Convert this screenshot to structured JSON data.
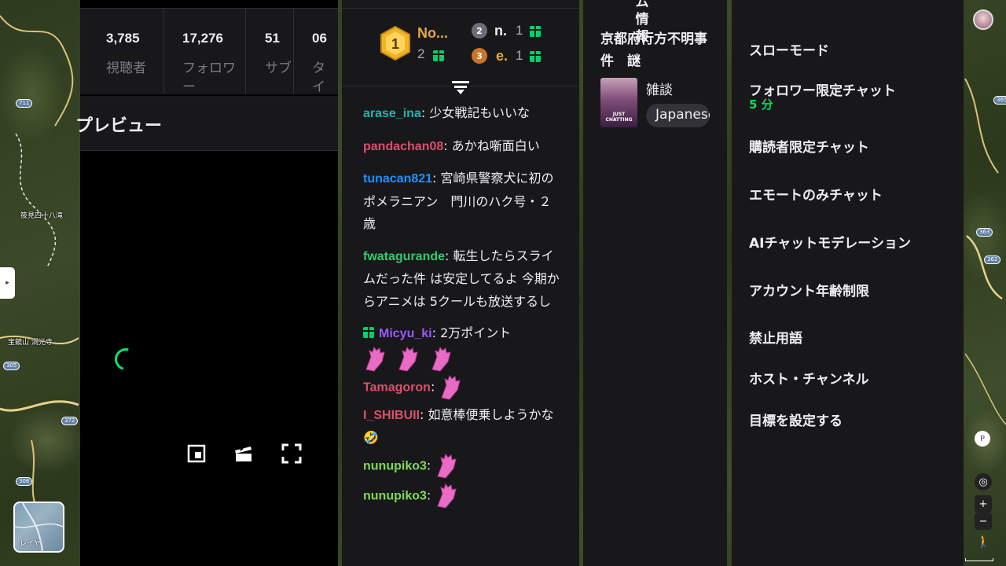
{
  "map": {
    "labels": {
      "falls": "筱見四十八滝",
      "temple": "宝鏡山 洞光寺"
    },
    "routes": [
      "711",
      "305",
      "372",
      "306",
      "363",
      "362",
      "365"
    ],
    "layer_button_label": "レイヤ",
    "controls": {
      "zoom_in": "+",
      "zoom_out": "−"
    }
  },
  "stats": {
    "items": [
      {
        "value": "3,785",
        "label": "視聴者"
      },
      {
        "value": "17,276",
        "label": "フォロワー"
      },
      {
        "value": "51",
        "label": "サブ"
      },
      {
        "value": "06",
        "label": "タイ"
      }
    ],
    "preview_title": "プレビュー"
  },
  "chat": {
    "leaderboard": {
      "first": {
        "rank": "1",
        "name": "No...",
        "count": "2"
      },
      "second": {
        "rank": "2",
        "name": "n.",
        "count": "1"
      },
      "third": {
        "rank": "3",
        "name": "e.",
        "count": "1"
      }
    },
    "messages": [
      {
        "user": "arase_ina",
        "color": "#1fb6a8",
        "text": "少女戦記もいいな"
      },
      {
        "user": "pandachan08",
        "color": "#d9506a",
        "text": "あかね噺面白い"
      },
      {
        "user": "tunacan821",
        "color": "#1e90ff",
        "text": "宮崎県警察犬に初のポメラニアン　門川のハク号・２歳"
      },
      {
        "user": "fwatagurande",
        "color": "#2ecc71",
        "text": "転生したらスライムだった件 は安定してるよ 今期からアニメは 5クールも放送するし"
      },
      {
        "user": "Micyu_ki",
        "color": "#9b59ff",
        "text": "2万ポイント"
      },
      {
        "user": "Tamagoron",
        "color": "#d9506a",
        "text": ""
      },
      {
        "user": "I_SHIBUII",
        "color": "#d9506a",
        "text": "如意棒便乗しようかな🤣"
      },
      {
        "user": "nunupiko3",
        "color": "#7ed957",
        "text": ""
      },
      {
        "user": "nunupiko3",
        "color": "#7ed957",
        "text": ""
      }
    ]
  },
  "info": {
    "title_top": "ム情報",
    "title": "京都府行方不明事件　謎",
    "category": "雑談",
    "tag": "Japanese"
  },
  "mod": {
    "items": [
      {
        "label": "スローモード"
      },
      {
        "label": "フォロワー限定チャット",
        "sub": "5 分"
      },
      {
        "label": "購読者限定チャット"
      },
      {
        "label": "エモートのみチャット"
      },
      {
        "label": "AIチャットモデレーション"
      },
      {
        "label": "アカウント年齢制限"
      },
      {
        "label": "禁止用語"
      },
      {
        "label": "ホスト・チャンネル"
      },
      {
        "label": "目標を設定する"
      }
    ]
  },
  "colors": {
    "accent_green": "#00e05a",
    "gold": "#e8a93a",
    "panel_bg": "#18181b"
  }
}
